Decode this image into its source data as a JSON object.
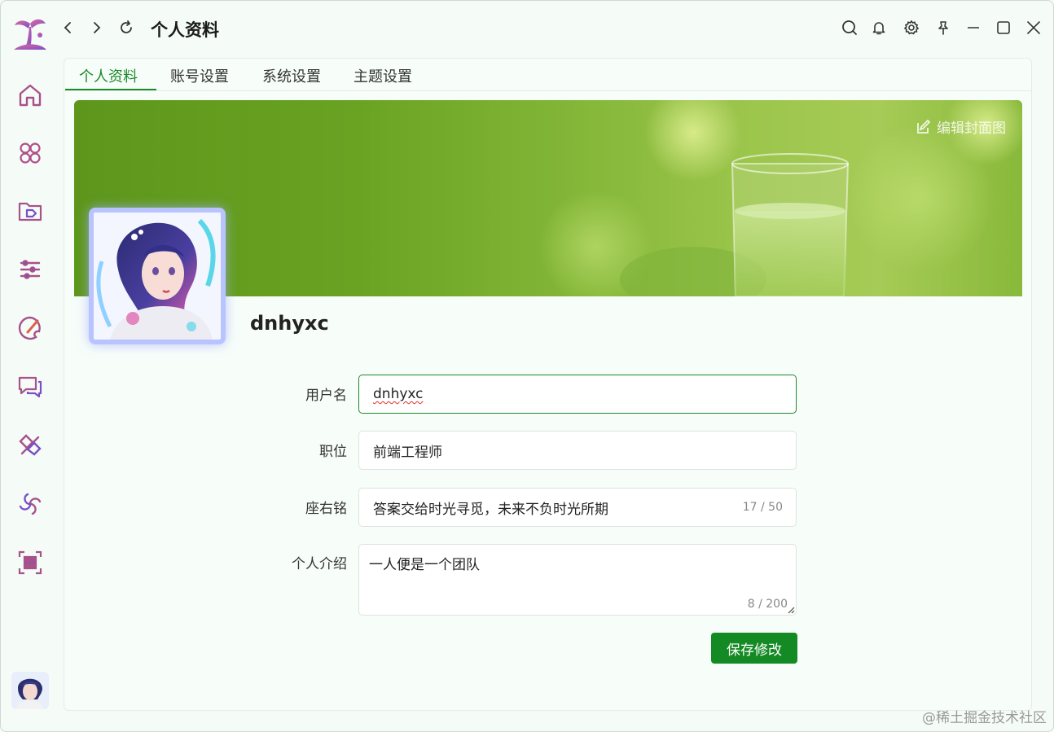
{
  "window": {
    "title": "个人资料"
  },
  "sidebar": {
    "items": [
      {
        "icon": "home-icon"
      },
      {
        "icon": "apps-icon"
      },
      {
        "icon": "folder-tag-icon"
      },
      {
        "icon": "list-settings-icon"
      },
      {
        "icon": "palette-icon"
      },
      {
        "icon": "chat-icon"
      },
      {
        "icon": "tools-icon"
      },
      {
        "icon": "spiral-icon"
      },
      {
        "icon": "grid-icon"
      }
    ]
  },
  "tabs": [
    "个人资料",
    "账号设置",
    "系统设置",
    "主题设置"
  ],
  "cover": {
    "edit_label": "编辑封面图"
  },
  "profile": {
    "username": "dnhyxc"
  },
  "form": {
    "username_label": "用户名",
    "username_value": "dnhyxc",
    "job_label": "职位",
    "job_value": "前端工程师",
    "motto_label": "座右铭",
    "motto_value": "答案交给时光寻觅，未来不负时光所期",
    "motto_counter": "17 / 50",
    "intro_label": "个人介绍",
    "intro_value": "一人便是一个团队",
    "intro_counter": "8 / 200",
    "save_label": "保存修改"
  },
  "watermark": "@稀土掘金技术社区",
  "colors": {
    "accent": "#1b8a2a",
    "button": "#148a24"
  }
}
